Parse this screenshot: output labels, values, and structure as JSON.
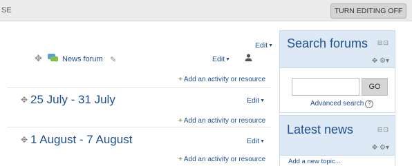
{
  "topbar": {
    "crumb": "SE",
    "turn_editing": "TURN EDITING OFF"
  },
  "sections": {
    "forum": {
      "edit_label": "Edit",
      "activity_edit_label": "Edit",
      "forum_name": "News forum",
      "add_label": "Add an activity or resource"
    },
    "week1": {
      "title": "25 July - 31 July",
      "edit_label": "Edit",
      "add_label": "Add an activity or resource"
    },
    "week2": {
      "title": "1 August - 7 August",
      "edit_label": "Edit",
      "add_label": "Add an activity or resource"
    }
  },
  "search_block": {
    "title": "Search forums",
    "go_label": "GO",
    "advanced_search": "Advanced search",
    "input_value": ""
  },
  "news_block": {
    "title": "Latest news",
    "add_topic": "Add a new topic..."
  },
  "colors": {
    "link": "#1f4f8e",
    "block_header": "#ddeaf6",
    "topbar": "#ebebeb"
  },
  "icons": [
    "move-icon",
    "forum-icon",
    "pencil-icon",
    "user-icon",
    "caret-down-icon",
    "plus-icon",
    "dock-icon",
    "gear-icon",
    "help-icon"
  ]
}
